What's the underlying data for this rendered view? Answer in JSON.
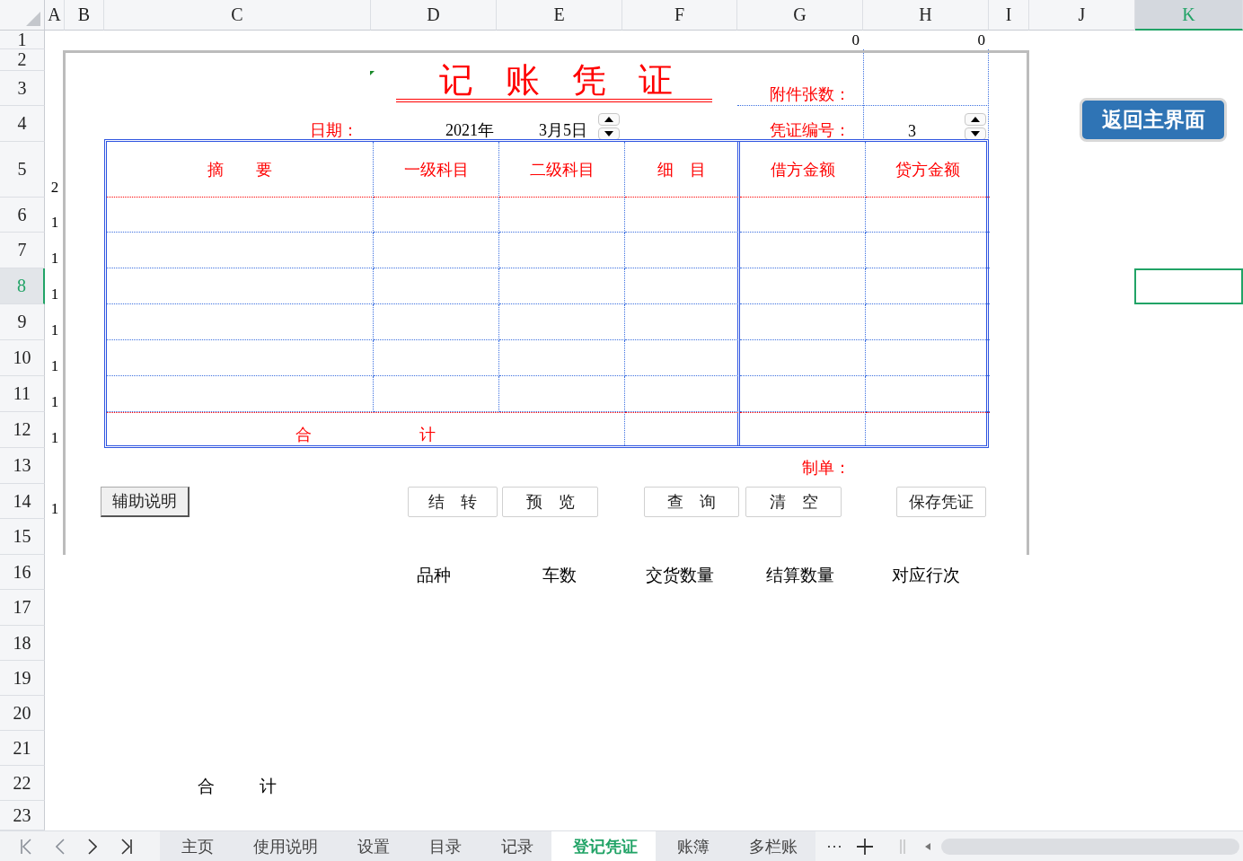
{
  "sheet": {
    "column_headers": [
      {
        "label": "A",
        "selected": false
      },
      {
        "label": "B",
        "selected": false
      },
      {
        "label": "C",
        "selected": false
      },
      {
        "label": "D",
        "selected": false
      },
      {
        "label": "E",
        "selected": false
      },
      {
        "label": "F",
        "selected": false
      },
      {
        "label": "G",
        "selected": false
      },
      {
        "label": "H",
        "selected": false
      },
      {
        "label": "I",
        "selected": false
      },
      {
        "label": "J",
        "selected": false
      },
      {
        "label": "K",
        "selected": true
      }
    ],
    "row_headers": [
      {
        "label": "1",
        "selected": false
      },
      {
        "label": "2",
        "selected": false
      },
      {
        "label": "3",
        "selected": false
      },
      {
        "label": "4",
        "selected": false
      },
      {
        "label": "5",
        "selected": false,
        "col_a": "2"
      },
      {
        "label": "6",
        "selected": false,
        "col_a": "1"
      },
      {
        "label": "7",
        "selected": false,
        "col_a": "1"
      },
      {
        "label": "8",
        "selected": true,
        "col_a": "1"
      },
      {
        "label": "9",
        "selected": false,
        "col_a": "1"
      },
      {
        "label": "10",
        "selected": false,
        "col_a": "1"
      },
      {
        "label": "11",
        "selected": false,
        "col_a": "1"
      },
      {
        "label": "12",
        "selected": false,
        "col_a": "1"
      },
      {
        "label": "13",
        "selected": false
      },
      {
        "label": "14",
        "selected": false,
        "col_a": "1"
      },
      {
        "label": "15",
        "selected": false
      },
      {
        "label": "16",
        "selected": false
      },
      {
        "label": "17",
        "selected": false
      },
      {
        "label": "18",
        "selected": false
      },
      {
        "label": "19",
        "selected": false
      },
      {
        "label": "20",
        "selected": false
      },
      {
        "label": "21",
        "selected": false
      },
      {
        "label": "22",
        "selected": false
      },
      {
        "label": "23",
        "selected": false
      }
    ],
    "row_1": {
      "g": "0",
      "h": "0"
    }
  },
  "voucher": {
    "title": "记账凭证",
    "date_label": "日期：",
    "year": "2021年",
    "day": "3月5日",
    "attachments_label": "附件张数：",
    "number_label": "凭证编号：",
    "number": "3",
    "columns": [
      "摘　　要",
      "一级科目",
      "二级科目",
      "细　目",
      "借方金额",
      "贷方金额"
    ],
    "total_label": [
      "合",
      "计"
    ],
    "preparer_label": "制单：",
    "buttons": [
      {
        "label": "辅助说明",
        "kind": "raised"
      },
      {
        "label": "结　转",
        "kind": "flat"
      },
      {
        "label": "预　览",
        "kind": "flat"
      },
      {
        "label": "查　询",
        "kind": "flat"
      },
      {
        "label": "清　空",
        "kind": "flat"
      },
      {
        "label": "保存凭证",
        "kind": "flat"
      }
    ]
  },
  "return_button": "返回主界面",
  "summary_headers": [
    "品种",
    "车数",
    "交货数量",
    "结算数量",
    "对应行次"
  ],
  "summary_total": [
    "合",
    "计"
  ],
  "sheet_tabs": [
    {
      "label": "主页",
      "selected": false
    },
    {
      "label": "使用说明",
      "selected": false
    },
    {
      "label": "设置",
      "selected": false
    },
    {
      "label": "目录",
      "selected": false
    },
    {
      "label": "记录",
      "selected": false
    },
    {
      "label": "登记凭证",
      "selected": true
    },
    {
      "label": "账簿",
      "selected": false
    },
    {
      "label": "多栏账",
      "selected": false
    }
  ],
  "more_tabs": "···"
}
